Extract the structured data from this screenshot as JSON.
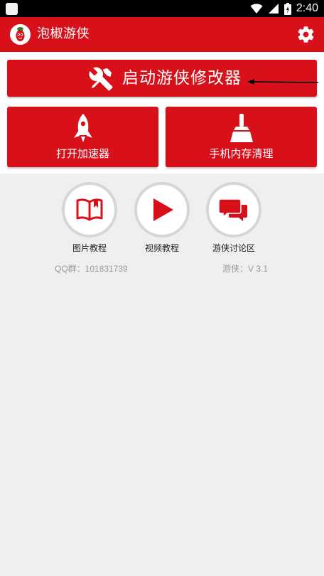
{
  "status_bar": {
    "time": "2:40"
  },
  "app_bar": {
    "title": "泡椒游侠"
  },
  "main_button": {
    "label": "启动游侠修改器"
  },
  "quick_actions": [
    {
      "label": "打开加速器"
    },
    {
      "label": "手机内存清理"
    }
  ],
  "tutorials": [
    {
      "label": "图片教程",
      "icon": "book-icon"
    },
    {
      "label": "视频教程",
      "icon": "play-icon"
    },
    {
      "label": "游侠讨论区",
      "icon": "chat-icon"
    }
  ],
  "footer_info": {
    "qq_group": "QQ群：101831739",
    "version": "游侠：V 3.1"
  },
  "colors": {
    "accent": "#d7101a",
    "background": "#efefef",
    "ring": "#d6d6d6"
  }
}
